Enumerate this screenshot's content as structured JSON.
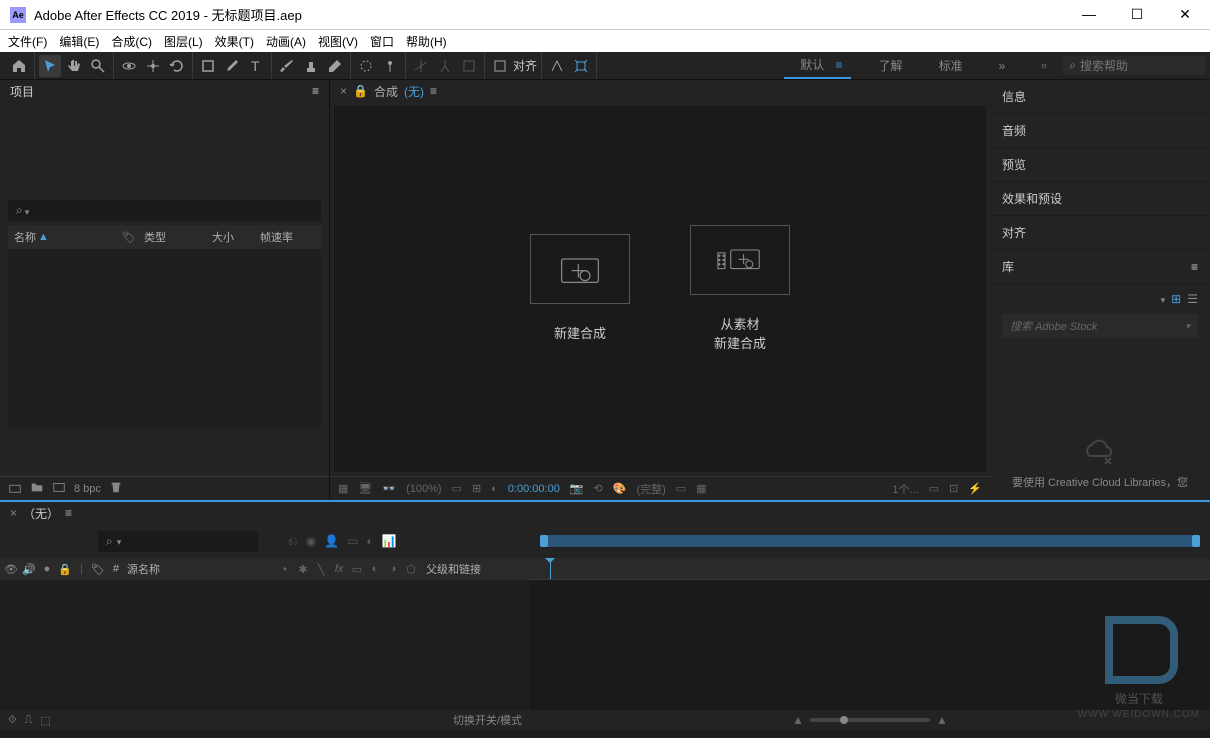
{
  "titlebar": {
    "app_icon": "Ae",
    "title": "Adobe After Effects CC 2019 - 无标题项目.aep"
  },
  "menubar": {
    "items": [
      "文件(F)",
      "编辑(E)",
      "合成(C)",
      "图层(L)",
      "效果(T)",
      "动画(A)",
      "视图(V)",
      "窗口",
      "帮助(H)"
    ]
  },
  "toolbar": {
    "align_label": "对齐",
    "workspaces": {
      "default": "默认",
      "learn": "了解",
      "standard": "标准"
    },
    "search_placeholder": "搜索帮助"
  },
  "project_panel": {
    "title": "项目",
    "columns": {
      "name": "名称",
      "type": "类型",
      "size": "大小",
      "frame_rate": "帧速率"
    },
    "footer": {
      "bpc": "8 bpc"
    }
  },
  "comp_panel": {
    "label": "合成",
    "none": "(无)",
    "placeholder_new": "新建合成",
    "placeholder_from_footage_l1": "从素材",
    "placeholder_from_footage_l2": "新建合成",
    "footer": {
      "zoom": "(100%)",
      "time": "0:00:00:00",
      "full": "(完整)",
      "view": "1个..."
    }
  },
  "right_panels": {
    "info": "信息",
    "audio": "音频",
    "preview": "预览",
    "effects": "效果和预设",
    "align": "对齐",
    "library": "库",
    "library_search": "搜索 Adobe Stock",
    "library_empty": "要使用 Creative Cloud Libraries，您"
  },
  "timeline": {
    "none": "（无）",
    "source_name": "源名称",
    "parent_link": "父级和链接",
    "switch_mode": "切换开关/模式"
  },
  "watermark": {
    "text": "微当下载",
    "url": "WWW.WEIDOWN.COM"
  }
}
